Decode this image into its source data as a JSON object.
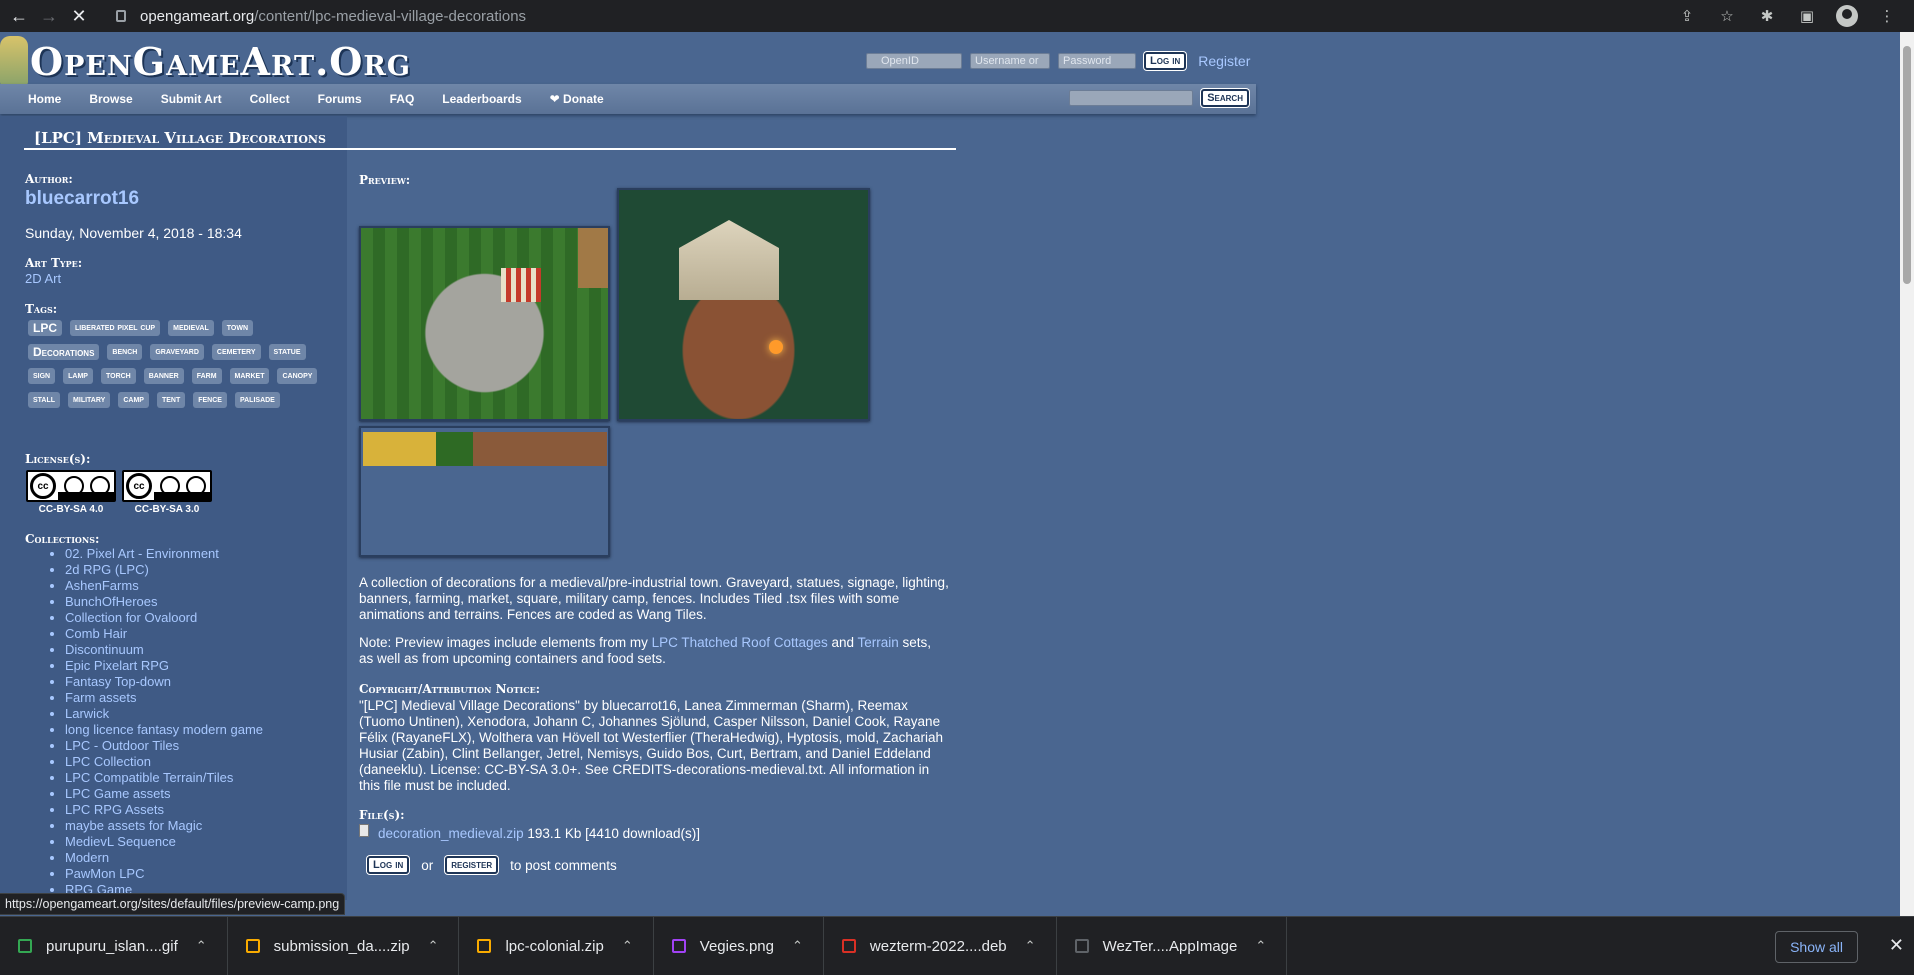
{
  "browser": {
    "url_host": "opengameart.org",
    "url_path": "/content/lpc-medieval-village-decorations",
    "back_icon": "←",
    "forward_icon": "→",
    "close_icon": "✕",
    "share_icon": "⇪",
    "star_icon": "☆",
    "extensions_icon": "✱",
    "sidepanel_icon": "▣",
    "menu_icon": "⋮"
  },
  "site": {
    "logo_text": "OpenGameArt.Org",
    "login": {
      "openid_placeholder": "OpenID",
      "username_placeholder": "Username or",
      "password_placeholder": "Password",
      "login_button": "Log in",
      "register_link": "Register"
    },
    "nav": [
      "Home",
      "Browse",
      "Submit Art",
      "Collect",
      "Forums",
      "FAQ",
      "Leaderboards",
      "❤ Donate"
    ],
    "search_button": "Search"
  },
  "page": {
    "title": "[LPC] Medieval Village Decorations",
    "author_label": "Author:",
    "author": "bluecarrot16",
    "date": "Sunday, November 4, 2018 - 18:34",
    "art_type_label": "Art Type:",
    "art_type": "2D Art",
    "tags_label": "Tags:",
    "tags": [
      "LPC",
      "liberated pixel cup",
      "medieval",
      "town",
      "Decorations",
      "bench",
      "graveyard",
      "cemetery",
      "statue",
      "sign",
      "lamp",
      "torch",
      "banner",
      "farm",
      "market",
      "canopy",
      "stall",
      "military",
      "camp",
      "tent",
      "fence",
      "palisade"
    ],
    "licenses_label": "License(s):",
    "licenses": [
      "CC-BY-SA 4.0",
      "CC-BY-SA 3.0"
    ],
    "license_badge_text": "cc",
    "collections_label": "Collections:",
    "collections": [
      "02. Pixel Art - Environment",
      "2d RPG (LPC)",
      "AshenFarms",
      "BunchOfHeroes",
      "Collection for Ovaloord",
      "Comb Hair",
      "Discontinuum",
      "Epic Pixelart RPG",
      "Fantasy Top-down",
      "Farm assets",
      "Larwick",
      "long licence fantasy modern game",
      "LPC - Outdoor Tiles",
      "LPC Collection",
      "LPC Compatible Terrain/Tiles",
      "LPC Game assets",
      "LPC RPG Assets",
      "maybe assets for Magic",
      "MedievL Sequence",
      "Modern",
      "PawMon LPC",
      "RPG Game"
    ],
    "preview_label": "Preview:",
    "description": "A collection of decorations for a medieval/pre-industrial town. Graveyard, statues, signage, lighting, banners, farming, market, square, military camp, fences. Includes Tiled .tsx files with some animations and terrains. Fences are coded as Wang Tiles.",
    "note_prefix": "Note: Preview images include elements from my ",
    "note_link1": "LPC Thatched Roof Cottages",
    "note_and": " and ",
    "note_link2": "Terrain",
    "note_suffix": " sets, as well as from upcoming containers and food sets.",
    "copyright_label": "Copyright/Attribution Notice:",
    "copyright": "\"[LPC] Medieval Village Decorations\" by bluecarrot16, Lanea Zimmerman (Sharm), Reemax (Tuomo Untinen), Xenodora, Johann C, Johannes Sjölund, Casper Nilsson, Daniel Cook, Rayane Félix (RayaneFLX), Wolthera van Hövell tot Westerflier (TheraHedwig), Hyptosis, mold, Zachariah Husiar (Zabin), Clint Bellanger, Jetrel, Nemisys, Guido Bos, Curt, Bertram, and Daniel Eddeland (daneeklu). License: CC-BY-SA 3.0+. See CREDITS-decorations-medieval.txt. All information in this file must be included.",
    "files_label": "File(s):",
    "file_name": "decoration_medieval.zip",
    "file_info": " 193.1 Kb [4410 download(s)]",
    "comment_login": "Log in",
    "comment_or": "or",
    "comment_register": "register",
    "comment_suffix": "to post comments"
  },
  "status_url": "https://opengameart.org/sites/default/files/preview-camp.png",
  "downloads": {
    "items": [
      {
        "name": "purupuru_islan....gif",
        "color": "#34a853"
      },
      {
        "name": "submission_da....zip",
        "color": "#f9ab00"
      },
      {
        "name": "lpc-colonial.zip",
        "color": "#f9ab00"
      },
      {
        "name": "Vegies.png",
        "color": "#a142f4"
      },
      {
        "name": "wezterm-2022....deb",
        "color": "#d93025"
      },
      {
        "name": "WezTer....AppImage",
        "color": "#5f6368"
      }
    ],
    "chevron": "⌃",
    "show_all": "Show all",
    "close": "✕"
  }
}
